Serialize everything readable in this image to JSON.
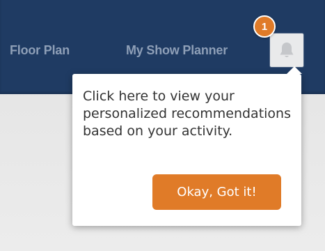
{
  "navbar": {
    "items": [
      {
        "label": "Floor Plan"
      },
      {
        "label": "My Show Planner"
      }
    ],
    "notification_icon": "bell-icon"
  },
  "tour": {
    "step_number": "1",
    "message": "Click here to view your personalized recommendations based on your activity.",
    "confirm_label": "Okay, Got it!"
  },
  "colors": {
    "navbar": "#1f3b63",
    "accent": "#e07b28",
    "nav_text": "#8e9fb7"
  }
}
